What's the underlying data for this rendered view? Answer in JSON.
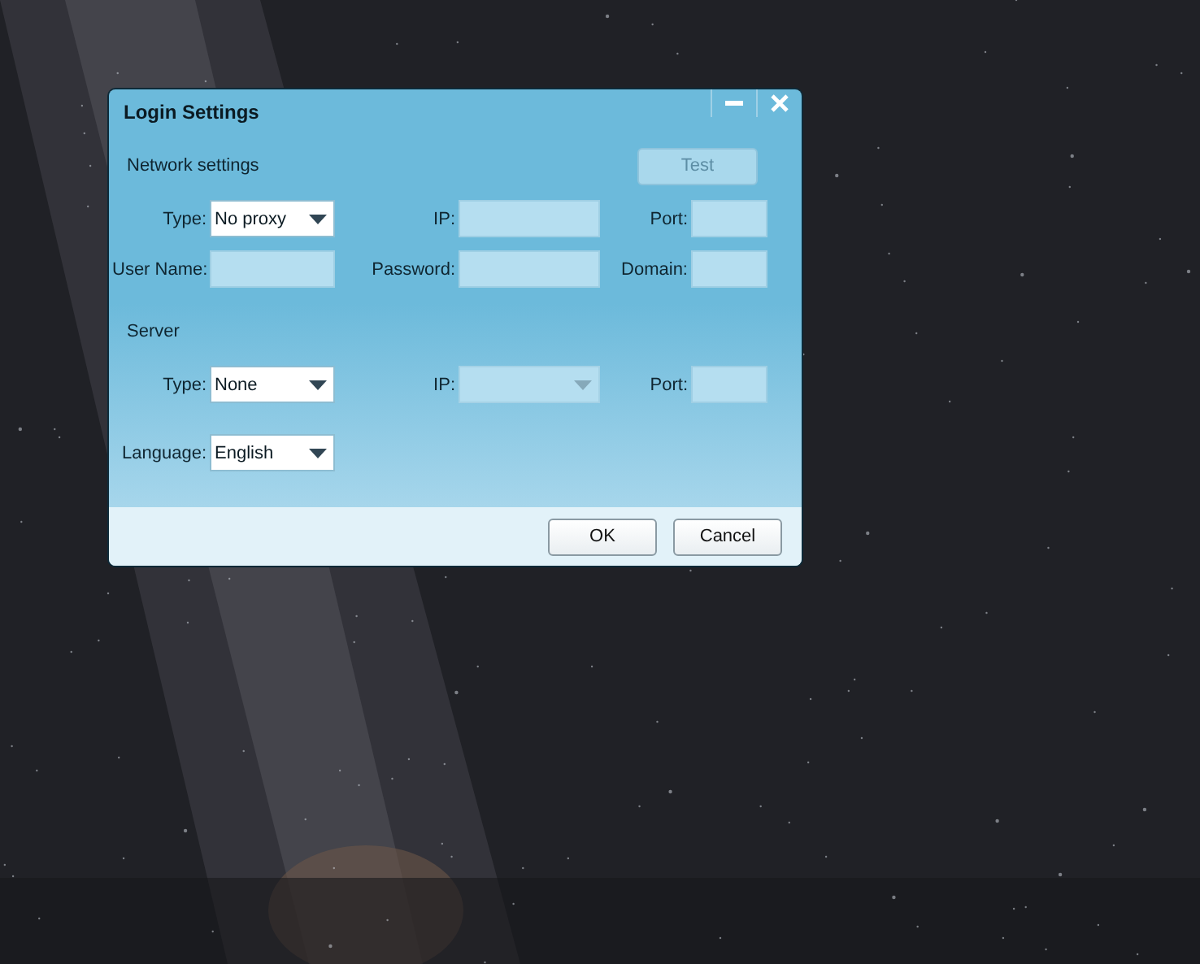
{
  "dialog": {
    "title": "Login Settings",
    "network": {
      "heading": "Network settings",
      "test_button": {
        "label": "Test",
        "disabled": true
      },
      "rows": [
        [
          {
            "label": "Type:",
            "kind": "dropdown",
            "value": "No proxy",
            "disabled": false
          },
          {
            "label": "IP:",
            "kind": "text",
            "disabled": true
          },
          {
            "label": "Port:",
            "kind": "text",
            "disabled": true
          }
        ],
        [
          {
            "label": "User Name:",
            "kind": "text",
            "disabled": true
          },
          {
            "label": "Password:",
            "kind": "text",
            "disabled": true
          },
          {
            "label": "Domain:",
            "kind": "text",
            "disabled": true
          }
        ]
      ]
    },
    "server": {
      "heading": "Server",
      "rows": [
        [
          {
            "label": "Type:",
            "kind": "dropdown",
            "value": "None",
            "disabled": false
          },
          {
            "label": "IP:",
            "kind": "dropdown",
            "disabled": true
          },
          {
            "label": "Port:",
            "kind": "text",
            "disabled": true
          }
        ]
      ]
    },
    "language": {
      "label": "Language:",
      "kind": "dropdown",
      "value": "English",
      "disabled": false
    },
    "buttons": [
      "OK",
      "Cancel"
    ]
  }
}
